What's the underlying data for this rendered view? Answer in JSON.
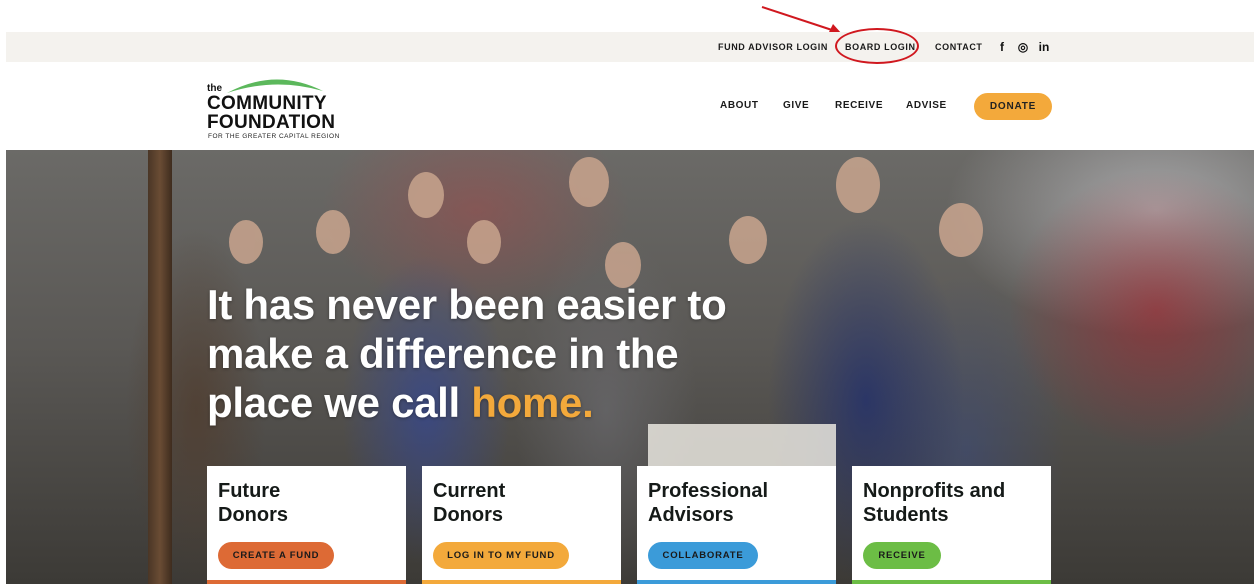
{
  "utility_bar": {
    "links": [
      {
        "label": "FUND ADVISOR LOGIN"
      },
      {
        "label": "BOARD LOGIN"
      },
      {
        "label": "CONTACT"
      }
    ],
    "social_icons": [
      "facebook-icon",
      "instagram-icon",
      "linkedin-icon"
    ],
    "social_glyphs": [
      "f",
      "◎",
      "in"
    ]
  },
  "logo": {
    "the": "the",
    "line1": "COMMUNITY",
    "line2": "FOUNDATION",
    "tagline": "FOR THE GREATER CAPITAL REGION"
  },
  "nav": {
    "items": [
      "ABOUT",
      "GIVE",
      "RECEIVE",
      "ADVISE"
    ],
    "donate": "DONATE"
  },
  "hero": {
    "headline_1": "It has never been easier to",
    "headline_2": "make a difference in the",
    "headline_3": "place we call ",
    "headline_accent": "home."
  },
  "cards": [
    {
      "title_1": "Future",
      "title_2": "Donors",
      "button": "CREATE A FUND",
      "color": "#dd6a35"
    },
    {
      "title_1": "Current",
      "title_2": "Donors",
      "button": "LOG IN TO MY FUND",
      "color": "#f3a93b"
    },
    {
      "title_1": "Professional",
      "title_2": "Advisors",
      "button": "COLLABORATE",
      "color": "#3b9bd9"
    },
    {
      "title_1": "Nonprofits and",
      "title_2": "Students",
      "button": "RECEIVE",
      "color": "#6cbd45"
    }
  ],
  "colors": {
    "accent_orange": "#f3a93b",
    "logo_green": "#5cb85c",
    "annotation_red": "#d0181f"
  }
}
